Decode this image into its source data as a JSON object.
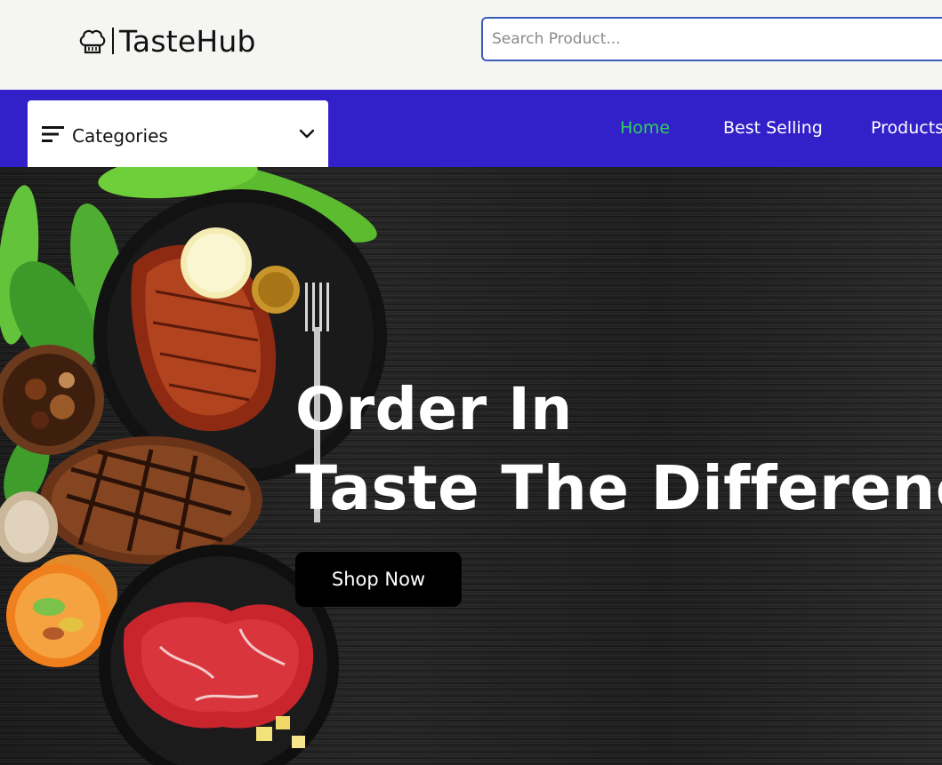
{
  "header": {
    "brand": "TasteHub",
    "logo_icon": "chef-hat-icon",
    "search": {
      "placeholder": "Search Product...",
      "value": ""
    }
  },
  "nav": {
    "categories_label": "Categories",
    "menu_icon": "menu-lines-icon",
    "dropdown_icon": "chevron-down-icon",
    "links": [
      {
        "label": "Home",
        "active": true
      },
      {
        "label": "Best Selling",
        "active": false
      },
      {
        "label": "Products",
        "active": false
      }
    ]
  },
  "hero": {
    "headline_line1": "Order In",
    "headline_line2": "Taste The Difference",
    "cta_label": "Shop Now"
  },
  "colors": {
    "nav_background": "#3220c9",
    "active_link": "#2ed35a",
    "search_border": "#3b5fb8",
    "header_background": "#f5f5f3",
    "hero_background": "#222222"
  }
}
